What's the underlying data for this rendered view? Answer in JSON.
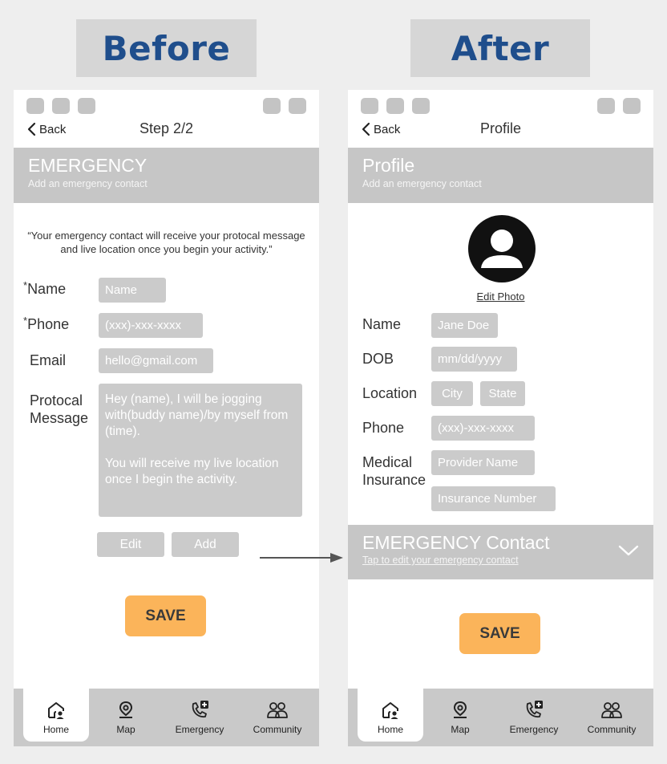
{
  "headings": {
    "before": "Before",
    "after": "After"
  },
  "before": {
    "nav": {
      "back": "Back",
      "title": "Step 2/2"
    },
    "banner": {
      "title": "EMERGENCY",
      "subtitle": "Add an emergency contact"
    },
    "quote": "“Your emergency contact will receive your protocal message and live location once you begin your activity.”",
    "fields": {
      "name": {
        "label": "Name",
        "required": "*",
        "placeholder": "Name"
      },
      "phone": {
        "label": "Phone",
        "required": "*",
        "placeholder": "(xxx)-xxx-xxxx"
      },
      "email": {
        "label": "Email",
        "placeholder": "hello@gmail.com"
      },
      "message": {
        "label": "Protocal Message",
        "value": "Hey (name), I will be jogging with(buddy name)/by myself from (time).\n\nYou will receive my live location once I begin the activity."
      }
    },
    "buttons": {
      "edit": "Edit",
      "add": "Add",
      "save": "SAVE"
    }
  },
  "after": {
    "nav": {
      "back": "Back",
      "title": "Profile"
    },
    "banner": {
      "title": "Profile",
      "subtitle": "Add an emergency contact"
    },
    "edit_photo": "Edit Photo",
    "fields": {
      "name": {
        "label": "Name",
        "value": "Jane Doe"
      },
      "dob": {
        "label": "DOB",
        "placeholder": "mm/dd/yyyy"
      },
      "location": {
        "label": "Location",
        "city": "City",
        "state": "State"
      },
      "phone": {
        "label": "Phone",
        "placeholder": "(xxx)-xxx-xxxx"
      },
      "insurance": {
        "label": "Medical Insurance",
        "provider": "Provider Name",
        "number": "Insurance Number"
      }
    },
    "emergency": {
      "title": "EMERGENCY Contact",
      "subtitle": "Tap to edit your emergency contact"
    },
    "buttons": {
      "save": "SAVE"
    }
  },
  "tabbar": {
    "home": "Home",
    "map": "Map",
    "emergency": "Emergency",
    "community": "Community",
    "active": "home"
  },
  "colors": {
    "heading": "#1f4e8c",
    "save": "#fbb45a",
    "gray": "#c6c6c6"
  }
}
